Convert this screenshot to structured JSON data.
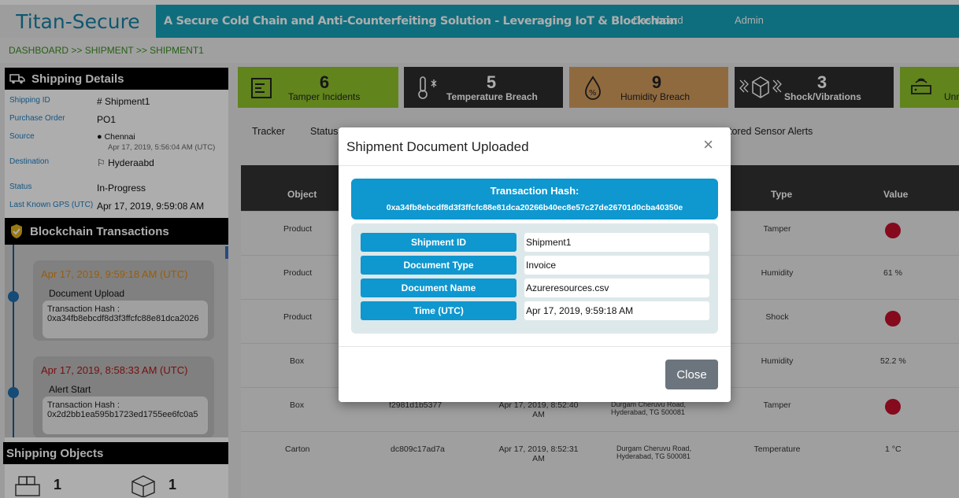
{
  "app": {
    "brand": "Titan-Secure",
    "tagline": "A Secure Cold Chain and Anti-Counterfeiting Solution - Leveraging IoT & Blockchain",
    "nav": [
      "Dashboard",
      "Admin"
    ]
  },
  "breadcrumb": "DASHBOARD >> SHIPMENT >> SHIPMENT1",
  "shipping_details": {
    "title": "Shipping Details",
    "shipping_id": {
      "label": "Shipping ID",
      "value": "# Shipment1"
    },
    "purchase_order": {
      "label": "Purchase Order",
      "value": "PO1"
    },
    "source": {
      "label": "Source",
      "value": "Chennai",
      "time": "Apr 17, 2019, 5:56:04 AM (UTC)"
    },
    "destination": {
      "label": "Destination",
      "value": "Hyderaabd"
    },
    "status": {
      "label": "Status",
      "value": "In-Progress"
    },
    "gps": {
      "label": "Last Known GPS (UTC)",
      "value": "Apr 17, 2019, 9:59:08 AM"
    }
  },
  "blockchain": {
    "title": "Blockchain Transactions",
    "items": [
      {
        "time": "Apr 17, 2019, 9:59:18 AM (UTC)",
        "event": "Document Upload",
        "hash_label": "Transaction Hash :",
        "hash": "0xa34fb8ebcdf8d3f3ffcfc88e81dca2026",
        "color": "#e08a12"
      },
      {
        "time": "Apr 17, 2019, 8:58:33 AM (UTC)",
        "event": "Alert Start",
        "hash_label": "Transaction Hash :",
        "hash": "0x2d2bb1ea595b1723ed1755ee6fc0a5",
        "color": "#b01818"
      }
    ]
  },
  "shipping_objects": {
    "title": "Shipping Objects",
    "counts": [
      "1",
      "1"
    ]
  },
  "stats": [
    {
      "value": "6",
      "label": "Tamper Incidents",
      "color": "#8fc32b",
      "icon": "tamper-icon"
    },
    {
      "value": "5",
      "label": "Temperature Breach",
      "color": "#2d2d2d",
      "icon": "thermometer-icon"
    },
    {
      "value": "9",
      "label": "Humidity Breach",
      "color": "#d49d5e",
      "icon": "humidity-icon"
    },
    {
      "value": "3",
      "label": "Shock/Vibrations",
      "color": "#2d2d2d",
      "icon": "shock-box-icon"
    },
    {
      "value": "",
      "label": "Unn",
      "color": "#8fc32b",
      "icon": "router-icon"
    }
  ],
  "tabs": [
    "Tracker",
    "Status",
    "tored Sensor Alerts"
  ],
  "table": {
    "headers": [
      "Object",
      "Type",
      "Value"
    ],
    "rows": [
      {
        "object": "Product",
        "id": "",
        "time": "",
        "location": "",
        "type": "Tamper",
        "value": "",
        "alert": true
      },
      {
        "object": "Product",
        "id": "",
        "time": "",
        "location": "",
        "type": "Humidity",
        "value": "61 %",
        "alert": false
      },
      {
        "object": "Product",
        "id": "",
        "time": "",
        "location": "",
        "type": "Shock",
        "value": "",
        "alert": true
      },
      {
        "object": "Box",
        "id": "",
        "time": "",
        "location": "",
        "type": "Humidity",
        "value": "52.2 %",
        "alert": false
      },
      {
        "object": "Box",
        "id": "f2981d1b5377",
        "time": "Apr 17, 2019, 8:52:40 AM",
        "location": "Durgam Cheruvu Road, Hyderabad, TG 500081",
        "type": "Tamper",
        "value": "",
        "alert": true
      },
      {
        "object": "Carton",
        "id": "dc809c17ad7a",
        "time": "Apr 17, 2019, 8:52:31 AM",
        "location": "Durgam Cheruvu Road, Hyderabad, TG 500081",
        "type": "Temperature",
        "value": "1 °C",
        "alert": false
      }
    ]
  },
  "modal": {
    "title": "Shipment Document Uploaded",
    "close_x": "×",
    "hash_title": "Transaction Hash:",
    "hash_value": "0xa34fb8ebcdf8d3f3ffcfc88e81dca20266b40ec8e57c27de26701d0cba40350e",
    "fields": [
      {
        "label": "Shipment ID",
        "value": "Shipment1"
      },
      {
        "label": "Document Type",
        "value": "Invoice"
      },
      {
        "label": "Document Name",
        "value": "Azureresources.csv"
      },
      {
        "label": "Time (UTC)",
        "value": "Apr 17, 2019, 9:59:18 AM"
      }
    ],
    "close_button": "Close"
  }
}
